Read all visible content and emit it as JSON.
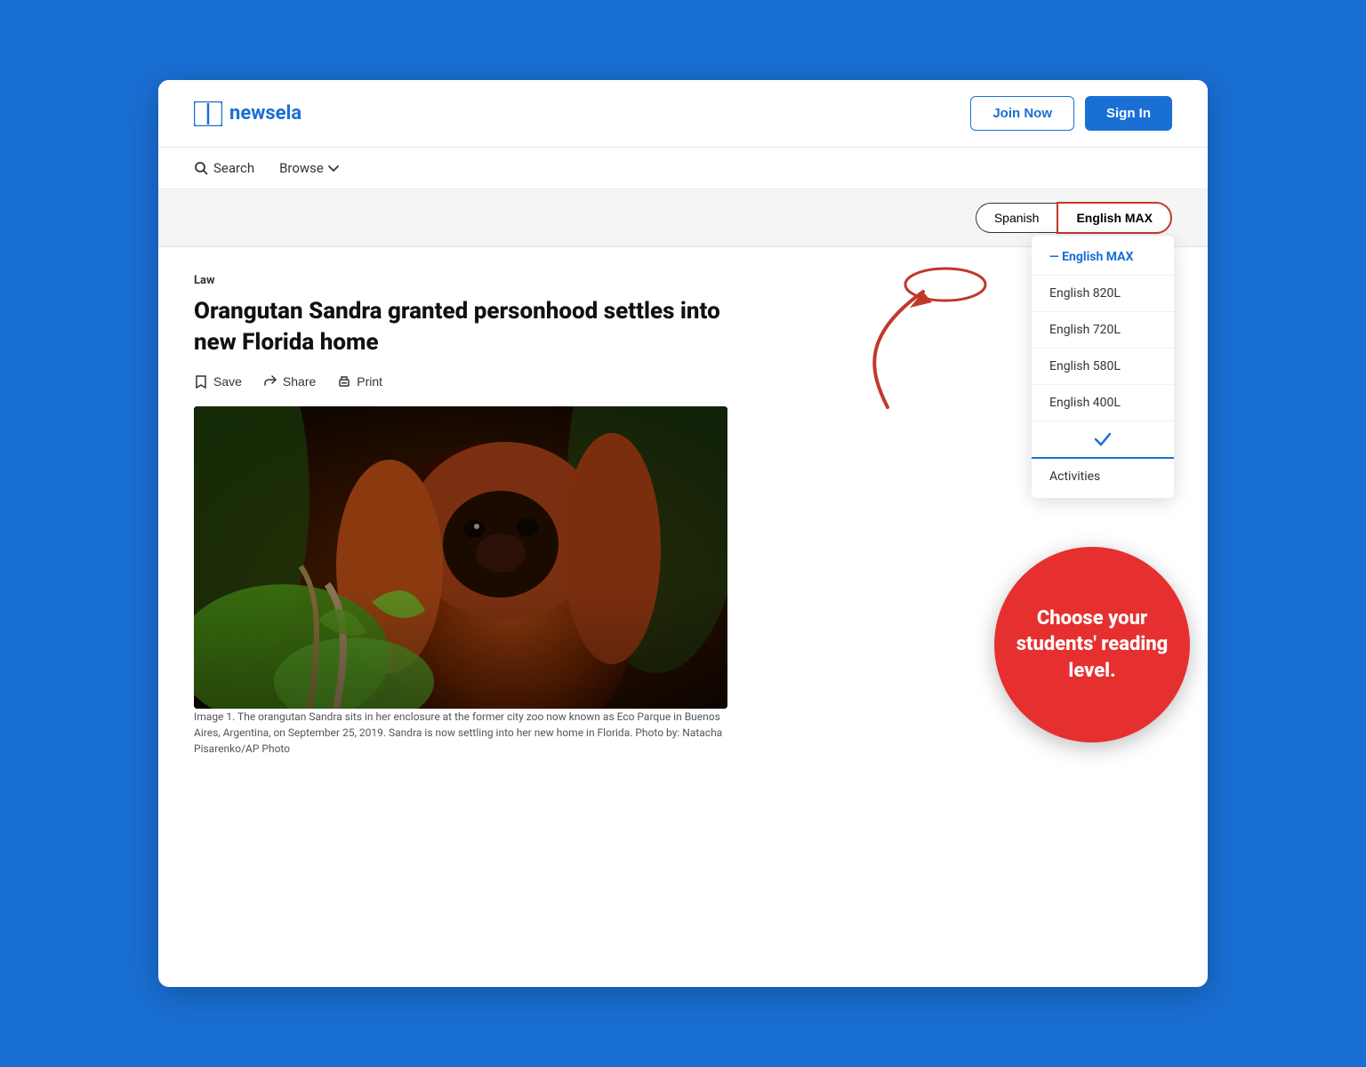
{
  "app": {
    "name": "newsela"
  },
  "header": {
    "join_label": "Join Now",
    "signin_label": "Sign In"
  },
  "nav": {
    "search_label": "Search",
    "browse_label": "Browse"
  },
  "language_selector": {
    "spanish_label": "Spanish",
    "english_max_label": "English MAX"
  },
  "dropdown": {
    "items": [
      {
        "label": "English MAX",
        "selected": true
      },
      {
        "label": "English 820L",
        "selected": false
      },
      {
        "label": "English 720L",
        "selected": false
      },
      {
        "label": "English 580L",
        "selected": false
      },
      {
        "label": "English 400L",
        "selected": false
      }
    ],
    "activities_label": "Activities"
  },
  "article": {
    "category": "Law",
    "title": "Orangutan Sandra granted personhood settles into new Florida home",
    "actions": {
      "save": "Save",
      "share": "Share",
      "print": "Print"
    },
    "caption": "Image 1. The orangutan Sandra sits in her enclosure at the former city zoo now known as Eco Parque in Buenos Aires, Argentina, on September 25, 2019. Sandra is now settling into her new home in Florida. Photo by: Natacha Pisarenko/AP Photo"
  },
  "callout": {
    "text": "Choose your students' reading level."
  }
}
